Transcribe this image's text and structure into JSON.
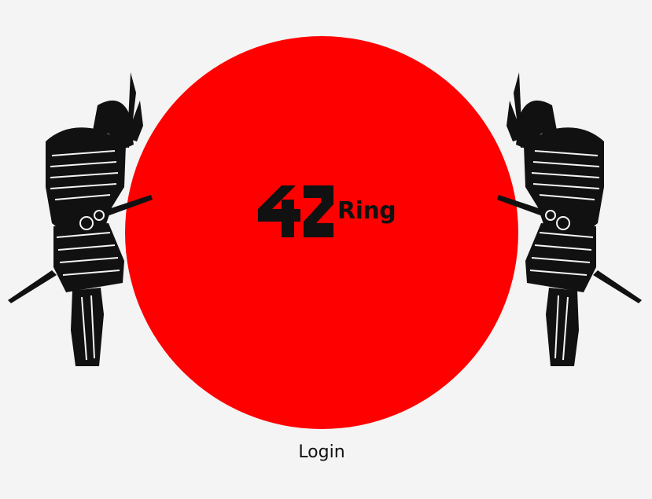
{
  "colors": {
    "background": "#f4f4f4",
    "sun": "#fe0000",
    "ink": "#111111"
  },
  "logo": {
    "numeral": "42",
    "wordmark": "Ring"
  },
  "illustrations": {
    "left": "samurai-icon",
    "right": "samurai-icon"
  },
  "login_label": "Login"
}
